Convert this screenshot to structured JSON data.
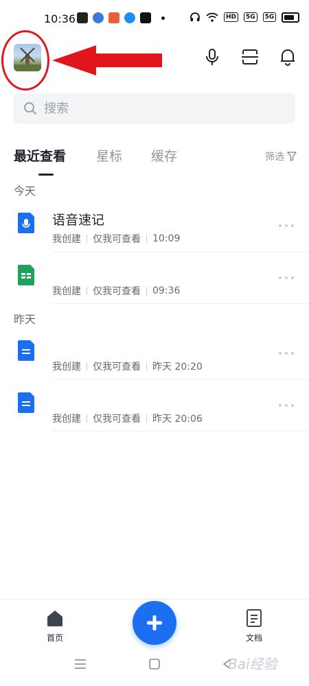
{
  "status_bar": {
    "time": "10:36",
    "sys_labels": [
      "HD",
      "5G",
      "5G"
    ]
  },
  "search": {
    "placeholder": "搜索"
  },
  "tabs": [
    {
      "label": "最近查看",
      "active": true
    },
    {
      "label": "星标",
      "active": false
    },
    {
      "label": "缓存",
      "active": false
    }
  ],
  "filter_label": "筛选",
  "sections": {
    "today": "今天",
    "yesterday": "昨天"
  },
  "files": [
    {
      "title": "语音速记",
      "icon": "voice-note-icon",
      "creator": "我创建",
      "visibility": "仅我可查看",
      "time": "10:09"
    },
    {
      "title": "",
      "icon": "sheet-icon",
      "creator": "我创建",
      "visibility": "仅我可查看",
      "time": "09:36"
    },
    {
      "title": "",
      "icon": "doc-icon",
      "creator": "我创建",
      "visibility": "仅我可查看",
      "time": "昨天 20:20"
    },
    {
      "title": "",
      "icon": "doc-icon",
      "creator": "我创建",
      "visibility": "仅我可查看",
      "time": "昨天 20:06"
    }
  ],
  "bottom_nav": {
    "home": "首页",
    "docs": "文档"
  },
  "colors": {
    "accent": "#1d6ff2",
    "annotation": "#e0161c",
    "sheet": "#1fa35b"
  },
  "watermark": "Bai经验"
}
